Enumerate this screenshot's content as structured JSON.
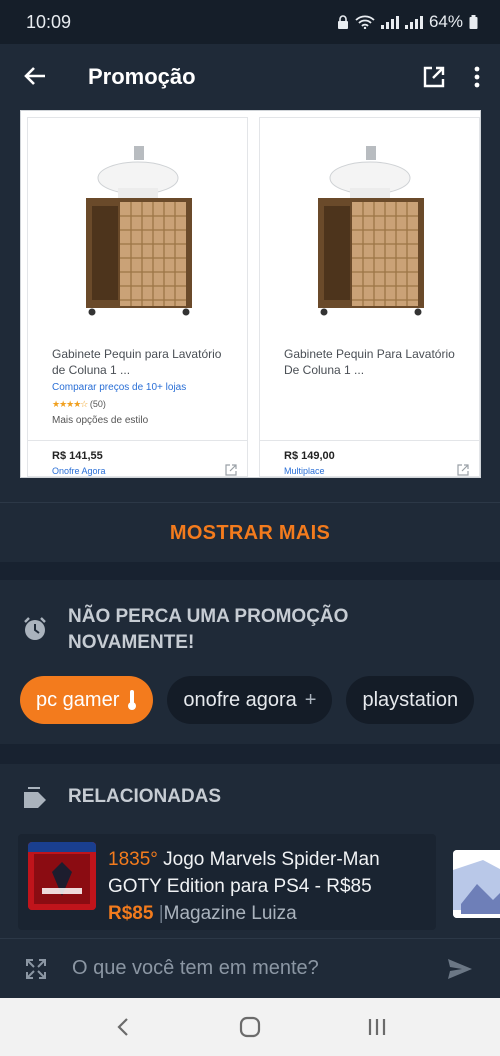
{
  "status_bar": {
    "time": "10:09",
    "battery": "64%"
  },
  "app_bar": {
    "title": "Promoção"
  },
  "screenshot": {
    "products": [
      {
        "title": "Gabinete Pequin para Lavatório de Coluna 1 ...",
        "compare": "Comparar preços de 10+ lojas",
        "reviews": "(50)",
        "more_styles": "Mais opções de estilo",
        "price": "R$ 141,55",
        "store": "Onofre Agora"
      },
      {
        "title": "Gabinete Pequin Para Lavatório De Coluna 1 ...",
        "price": "R$ 149,00",
        "store": "Multiplace"
      }
    ]
  },
  "show_more": "MOSTRAR MAIS",
  "alerts": {
    "title": "NÃO PERCA UMA PROMOÇÃO NOVAMENTE!",
    "chips": [
      {
        "label": "pc gamer",
        "icon": "thermometer-icon"
      },
      {
        "label": "onofre agora",
        "icon": "plus-icon"
      },
      {
        "label": "playstation",
        "icon": ""
      }
    ]
  },
  "related": {
    "title": "RELACIONADAS",
    "deal": {
      "temperature": "1835°",
      "title": "Jogo Marvels Spider-Man GOTY Edition para PS4 - R$85",
      "price": "R$85",
      "separator": "|",
      "store": "Magazine Luiza"
    }
  },
  "composer": {
    "placeholder": "O que você tem em mente?"
  },
  "colors": {
    "accent": "#f37b1d",
    "background": "#1f2a38"
  }
}
